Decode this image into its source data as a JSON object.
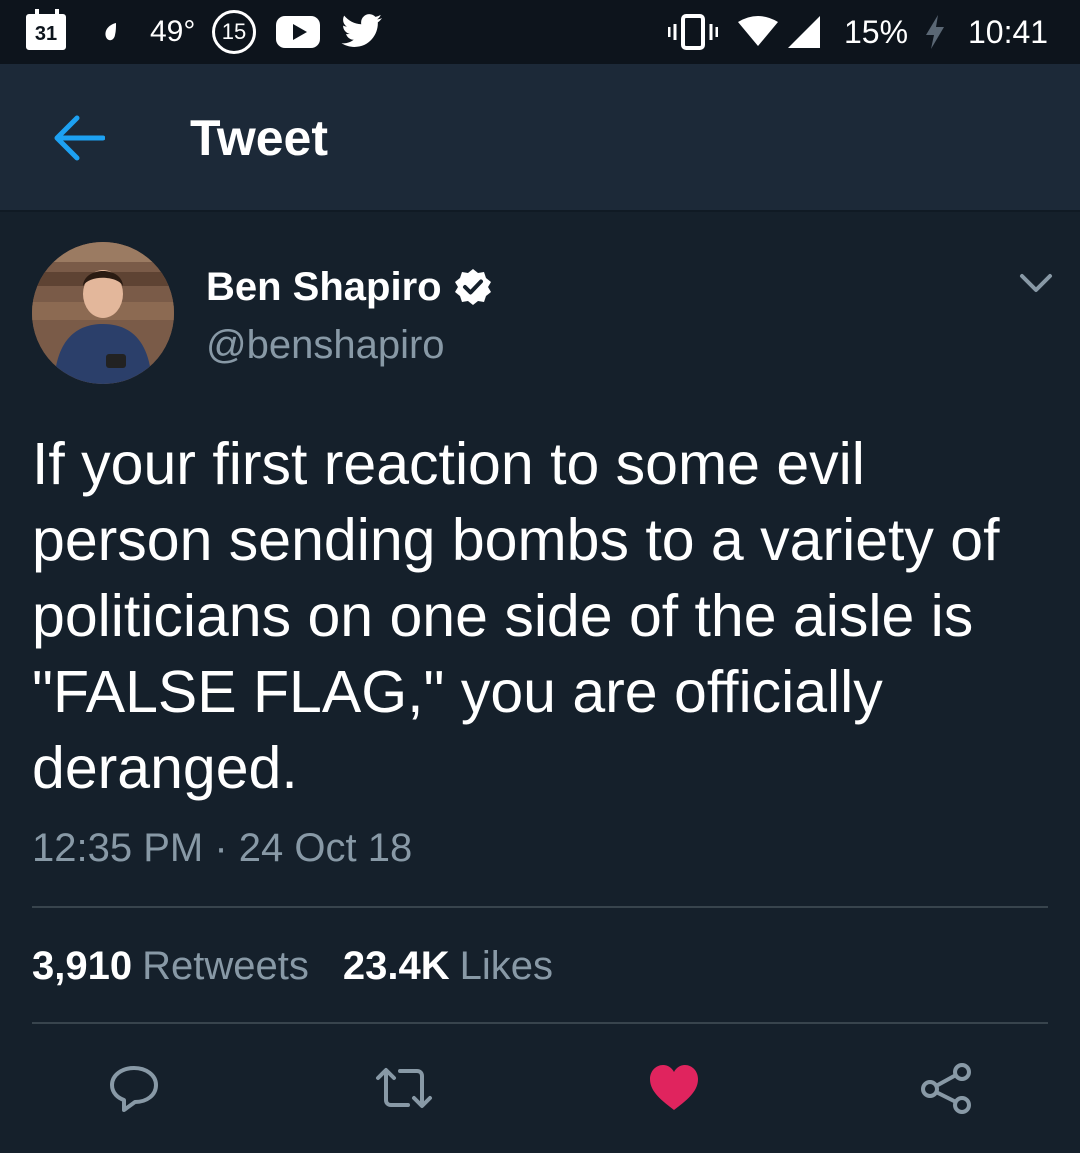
{
  "status_bar": {
    "calendar_day": "31",
    "temperature": "49°",
    "notification_count": "15",
    "battery": "15%",
    "time": "10:41",
    "icons": [
      "calendar-icon",
      "drop-icon",
      "notification-count-badge",
      "youtube-icon",
      "twitter-bird-icon",
      "vibrate-icon",
      "wifi-icon",
      "signal-icon",
      "charging-bolt-icon"
    ]
  },
  "header": {
    "title": "Tweet",
    "back_icon": "back-arrow-icon"
  },
  "tweet": {
    "author_name": "Ben Shapiro",
    "handle": "@benshapiro",
    "verified_icon": "verified-badge-icon",
    "text": "If your first reaction to some evil person sending bombs to a variety of politicians on one side of the aisle is \"FALSE FLAG,\" you are officially deranged.",
    "timestamp": "12:35 PM · 24 Oct 18"
  },
  "stats": {
    "retweets_count": "3,910",
    "retweets_label": "Retweets",
    "likes_count": "23.4K",
    "likes_label": "Likes"
  },
  "actions": {
    "icons": [
      "reply-icon",
      "retweet-icon",
      "like-heart-icon",
      "share-icon"
    ],
    "like_color": "#e0245e"
  },
  "colors": {
    "background": "#15202b",
    "header": "#1c2938",
    "accent": "#1da1f2",
    "secondary_text": "#8899a6"
  }
}
